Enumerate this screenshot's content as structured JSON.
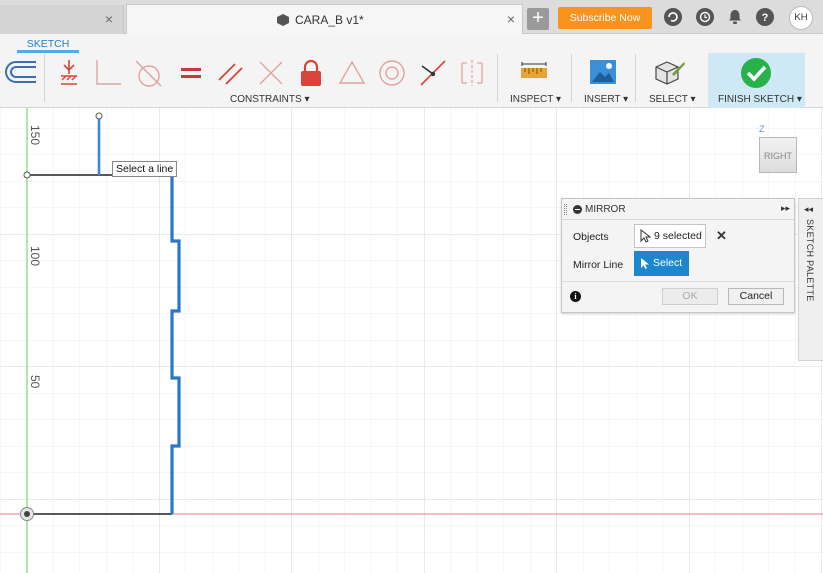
{
  "tabs": {
    "document_title": "CARA_B v1*",
    "close_glyph": "×",
    "new_tab_glyph": "+"
  },
  "header": {
    "subscribe_label": "Subscribe Now",
    "avatar_initials": "KH"
  },
  "toolbar": {
    "workspace_tab": "SKETCH",
    "groups": {
      "constraints": "CONSTRAINTS ▾",
      "inspect": "INSPECT ▾",
      "insert": "INSERT ▾",
      "select": "SELECT ▾",
      "finish": "FINISH SKETCH ▾"
    },
    "icons": [
      "fix-icon",
      "horizontal-vertical-icon",
      "tangent-icon",
      "equal-icon",
      "parallel-icon",
      "perpendicular-icon",
      "lock-icon",
      "midpoint-icon",
      "concentric-icon",
      "collinear-icon",
      "symmetry-icon"
    ],
    "accent_color": "#1f7fc6",
    "constraint_red": "#d9443a"
  },
  "canvas": {
    "tooltip": "Select a line",
    "axis_labels": [
      "150",
      "100",
      "50"
    ],
    "view_cube_face": "RIGHT",
    "view_cube_axis": "Z",
    "sketch_color": "#2a77c9"
  },
  "mirror_dialog": {
    "title": "MIRROR",
    "expand_glyph": "▸▸",
    "objects_label": "Objects",
    "objects_value": "9 selected",
    "clear_glyph": "✕",
    "mirror_line_label": "Mirror Line",
    "mirror_line_value": "Select",
    "info_glyph": "i",
    "ok_label": "OK",
    "cancel_label": "Cancel"
  },
  "sketch_palette": {
    "label": "SKETCH PALETTE",
    "collapse_glyph": "◂◂"
  }
}
